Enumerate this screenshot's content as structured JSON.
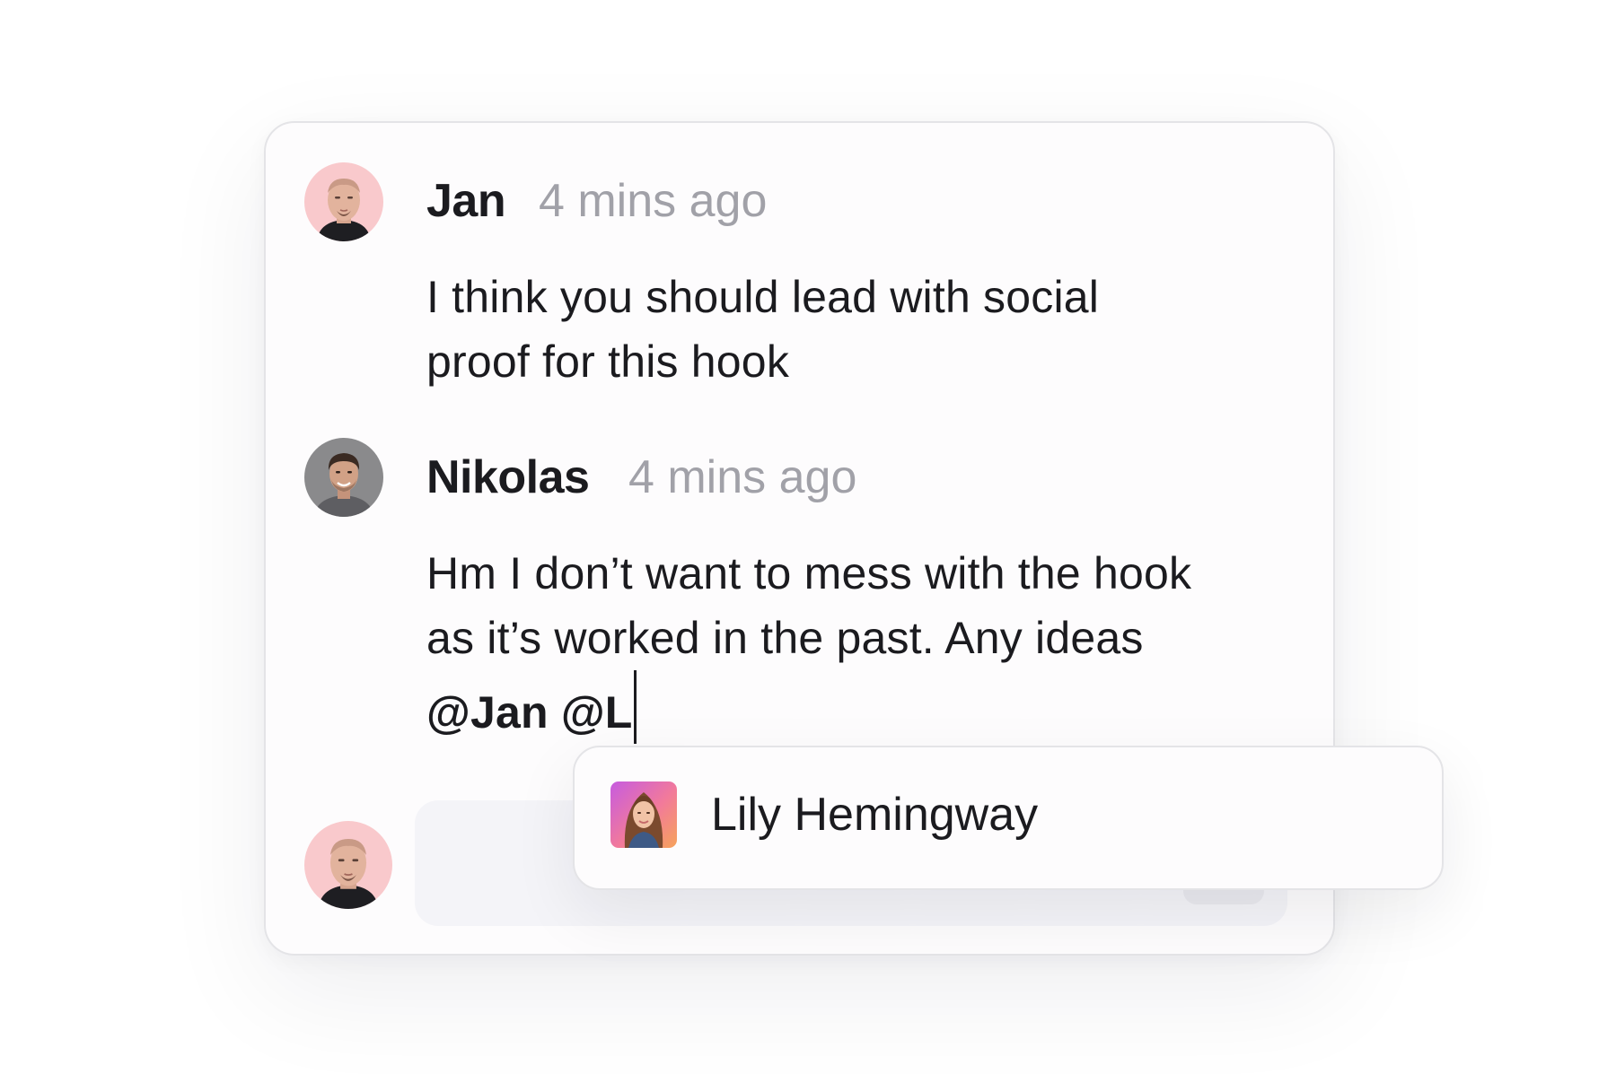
{
  "comments": [
    {
      "author": "Jan",
      "time": "4 mins ago",
      "text_lines": [
        "I think you should lead with social",
        "proof for this hook"
      ]
    },
    {
      "author": "Nikolas",
      "time": "4 mins ago",
      "text_lines": [
        "Hm I don’t want to mess with the hook",
        "as it’s worked in the past. Any ideas"
      ],
      "mentions": [
        "@Jan",
        "@L"
      ]
    }
  ],
  "mention_suggestions": [
    {
      "name": "Lily Hemingway"
    }
  ],
  "icons": {
    "jan_avatar": "avatar-jan-icon",
    "nikolas_avatar": "avatar-nikolas-icon",
    "current_user_avatar": "avatar-current-user-icon",
    "lily_avatar": "avatar-lily-icon"
  },
  "colors": {
    "card_border": "#e4e4e7",
    "timestamp": "#a1a1a8",
    "text": "#1b1b1f",
    "input_bg": "#f4f4f8"
  }
}
